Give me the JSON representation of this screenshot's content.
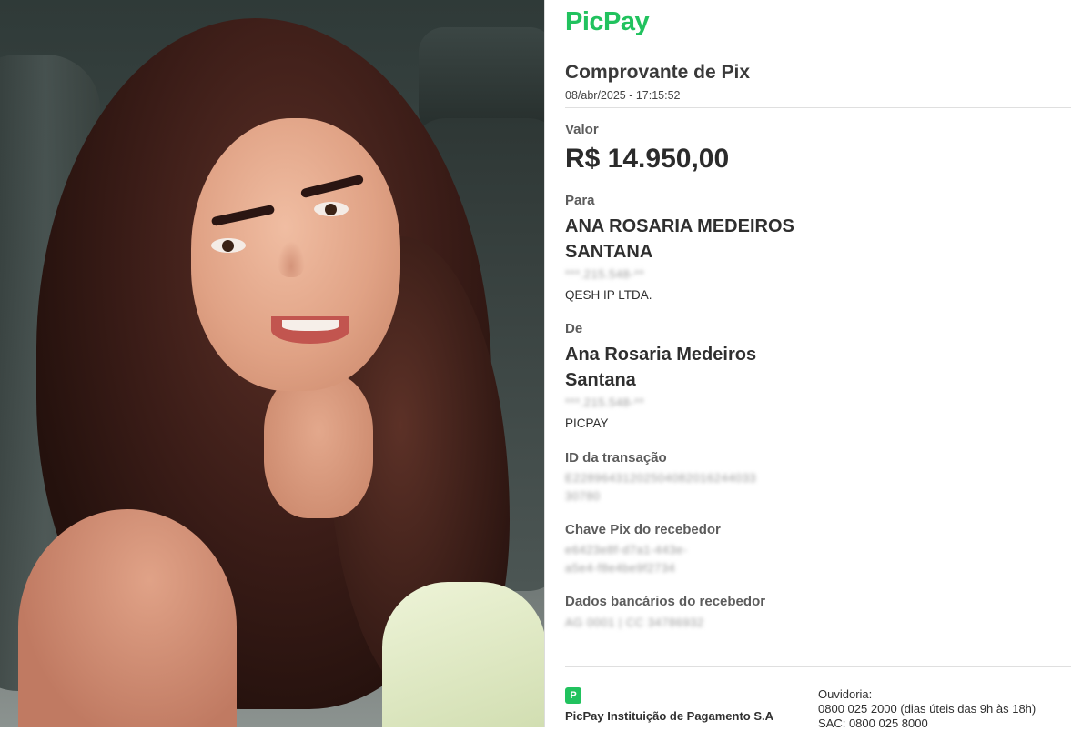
{
  "brand": {
    "name": "PicPay",
    "color": "#21c25e",
    "footer_icon": "picpay-logo-icon"
  },
  "receipt": {
    "title": "Comprovante de Pix",
    "datetime": "08/abr/2025 - 17:15:52",
    "valor_label": "Valor",
    "valor": "R$ 14.950,00",
    "para_label": "Para",
    "para_name": "ANA ROSARIA MEDEIROS SANTANA",
    "para_doc": "***.215.548-**",
    "para_bank": "QESH IP LTDA.",
    "de_label": "De",
    "de_name": "Ana Rosaria Medeiros Santana",
    "de_doc": "***.215.548-**",
    "de_bank": "PICPAY",
    "id_label": "ID da transação",
    "id_line1": "E22896431202504082016244033",
    "id_line2": "30780",
    "chave_label": "Chave Pix do recebedor",
    "chave_line1": "e6423e8f-d7a1-443e-",
    "chave_line2": "a5e4-f8e4be9f2734",
    "dados_label": "Dados bancários do recebedor",
    "dados_value": "AG 0001 | CC 34786932"
  },
  "footer": {
    "company": "PicPay Instituição de Pagamento S.A",
    "ouvidoria_label": "Ouvidoria:",
    "ouvidoria_phone": "0800 025 2000 (dias úteis das 9h às 18h)",
    "sac": "SAC: 0800 025 8000"
  }
}
